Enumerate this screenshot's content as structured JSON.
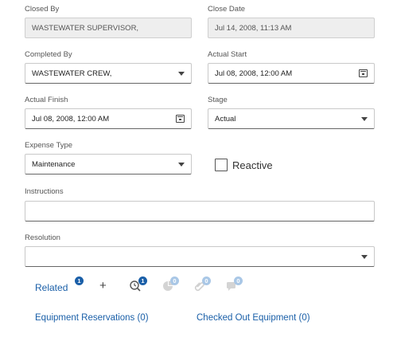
{
  "fields": {
    "closed_by": {
      "label": "Closed By",
      "value": "WASTEWATER SUPERVISOR,"
    },
    "close_date": {
      "label": "Close Date",
      "value": "Jul 14, 2008, 11:13 AM"
    },
    "completed_by": {
      "label": "Completed By",
      "value": "WASTEWATER CREW,"
    },
    "actual_start": {
      "label": "Actual Start",
      "value": "Jul 08, 2008, 12:00 AM"
    },
    "actual_finish": {
      "label": "Actual Finish",
      "value": "Jul 08, 2008, 12:00 AM"
    },
    "stage": {
      "label": "Stage",
      "value": "Actual"
    },
    "expense_type": {
      "label": "Expense Type",
      "value": "Maintenance"
    },
    "reactive": {
      "label": "Reactive",
      "checked": false
    },
    "instructions": {
      "label": "Instructions",
      "value": ""
    },
    "resolution": {
      "label": "Resolution",
      "value": ""
    }
  },
  "related": {
    "label": "Related",
    "count": "1",
    "add_symbol": "+",
    "tools": [
      {
        "icon": "search-clock-icon",
        "count": "1",
        "active": true
      },
      {
        "icon": "pie-chart-icon",
        "count": "0",
        "active": false
      },
      {
        "icon": "attachment-icon",
        "count": "0",
        "active": false
      },
      {
        "icon": "comment-icon",
        "count": "0",
        "active": false
      }
    ]
  },
  "links": {
    "equipment_reservations": "Equipment Reservations (0)",
    "checked_out_equipment": "Checked Out Equipment (0)"
  },
  "colors": {
    "accent": "#1a5fa8",
    "accent_muted": "#a9c7e6",
    "readonly_bg": "#eeeeee"
  }
}
